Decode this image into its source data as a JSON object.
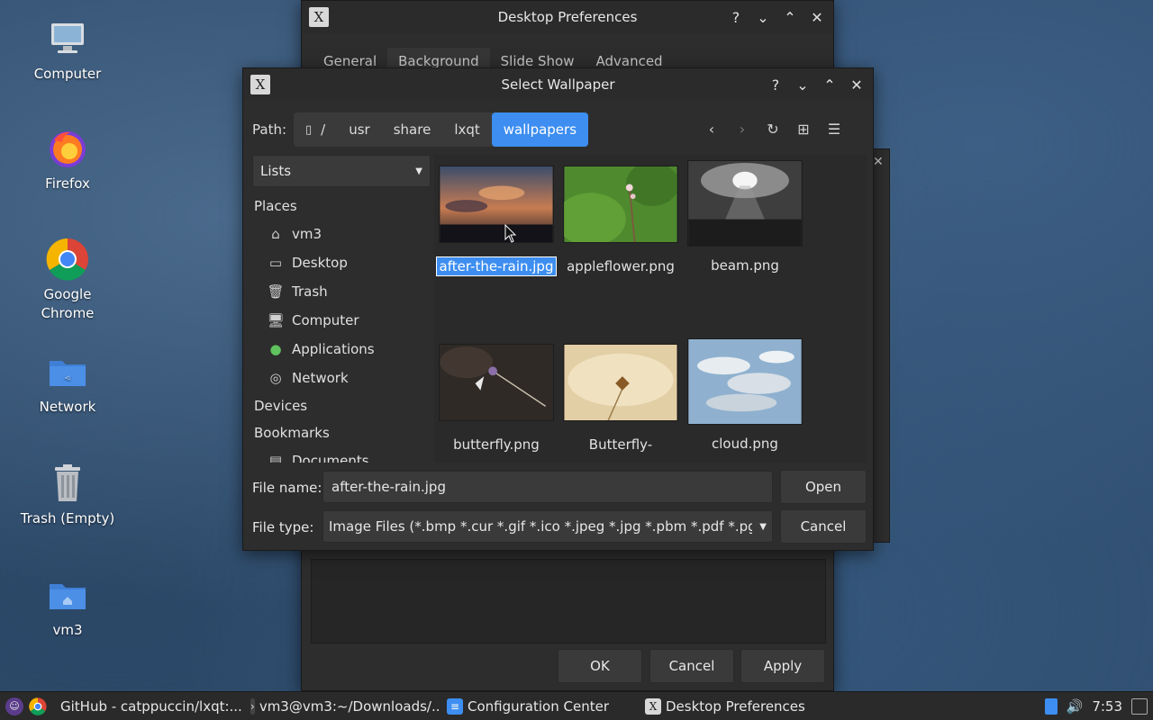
{
  "desktop": {
    "icons": [
      {
        "label": "Computer"
      },
      {
        "label": "Firefox"
      },
      {
        "label": "Google\nChrome"
      },
      {
        "label": "Network"
      },
      {
        "label": "Trash (Empty)"
      },
      {
        "label": "vm3"
      }
    ]
  },
  "prefs_window": {
    "title": "Desktop Preferences",
    "tabs": [
      "General",
      "Background",
      "Slide Show",
      "Advanced"
    ],
    "buttons": {
      "ok": "OK",
      "cancel": "Cancel",
      "apply": "Apply"
    }
  },
  "dialog": {
    "title": "Select Wallpaper",
    "path_label": "Path:",
    "path": [
      "/",
      "usr",
      "share",
      "lxqt",
      "wallpapers"
    ],
    "view_mode": "Lists",
    "places_header": "Places",
    "places": [
      {
        "label": "vm3",
        "icon": "home-icon"
      },
      {
        "label": "Desktop",
        "icon": "desktop-icon"
      },
      {
        "label": "Trash",
        "icon": "trash-icon"
      },
      {
        "label": "Computer",
        "icon": "computer-icon"
      },
      {
        "label": "Applications",
        "icon": "applications-icon"
      },
      {
        "label": "Network",
        "icon": "network-icon"
      }
    ],
    "devices_header": "Devices",
    "bookmarks_header": "Bookmarks",
    "bookmarks": [
      {
        "label": "Documents"
      }
    ],
    "files": [
      {
        "name": "after-the-rain.jpg",
        "selected": true
      },
      {
        "name": "appleflower.png"
      },
      {
        "name": "beam.png"
      },
      {
        "name": "butterfly.png"
      },
      {
        "name": "Butterfly-"
      },
      {
        "name": "cloud.png"
      }
    ],
    "file_name_label": "File name:",
    "file_name_value": "after-the-rain.jpg",
    "file_type_label": "File type:",
    "file_type_value": "Image Files (*.bmp *.cur *.gif *.ico *.jpeg *.jpg *.pbm *.pdf *.pgm",
    "open_label": "Open",
    "cancel_label": "Cancel",
    "accent": "#3d8ef0"
  },
  "taskbar": {
    "tasks": [
      {
        "label": "GitHub - catppuccin/lxqt:..."
      },
      {
        "label": "vm3@vm3:~/Downloads/..."
      },
      {
        "label": "Configuration Center"
      },
      {
        "label": "Desktop Preferences"
      }
    ],
    "clock": "7:53"
  }
}
